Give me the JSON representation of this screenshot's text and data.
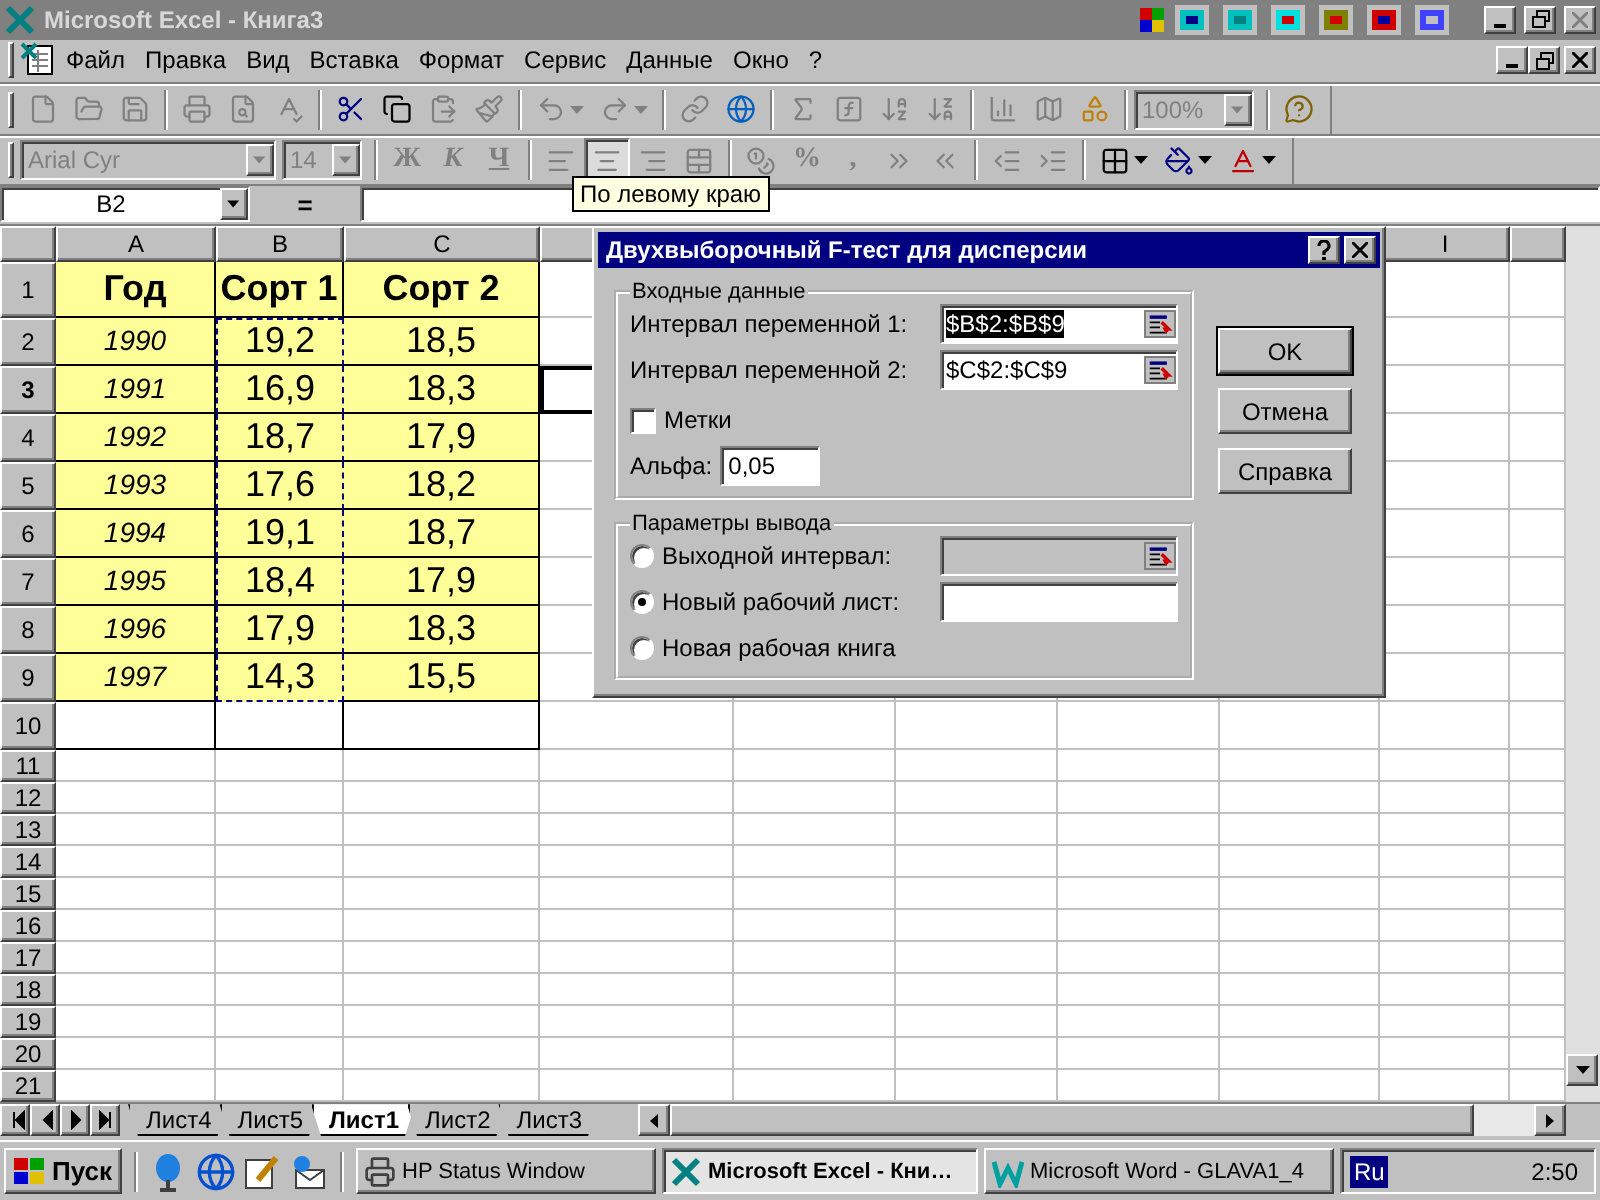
{
  "window": {
    "title": "Microsoft Excel - Книга3"
  },
  "menu": [
    "Файл",
    "Правка",
    "Вид",
    "Вставка",
    "Формат",
    "Сервис",
    "Данные",
    "Окно",
    "?"
  ],
  "standard_toolbar": [
    {
      "kind": "new",
      "disabled": true
    },
    {
      "kind": "open",
      "disabled": true
    },
    {
      "kind": "save",
      "disabled": true
    },
    {
      "kind": "separator"
    },
    {
      "kind": "print",
      "disabled": true
    },
    {
      "kind": "preview",
      "disabled": true
    },
    {
      "kind": "spelling",
      "disabled": true
    },
    {
      "kind": "separator"
    },
    {
      "kind": "cut",
      "disabled": false
    },
    {
      "kind": "copy",
      "disabled": false
    },
    {
      "kind": "paste",
      "disabled": true
    },
    {
      "kind": "painter",
      "disabled": true
    },
    {
      "kind": "separator"
    },
    {
      "kind": "undo",
      "disabled": true
    },
    {
      "kind": "redo",
      "disabled": true
    },
    {
      "kind": "separator"
    },
    {
      "kind": "hyperlink",
      "disabled": true
    },
    {
      "kind": "web",
      "disabled": false
    },
    {
      "kind": "separator"
    },
    {
      "kind": "sum",
      "disabled": true
    },
    {
      "kind": "function",
      "disabled": true
    },
    {
      "kind": "sort-asc",
      "disabled": true
    },
    {
      "kind": "sort-desc",
      "disabled": true
    },
    {
      "kind": "separator"
    },
    {
      "kind": "chart",
      "disabled": true
    },
    {
      "kind": "map",
      "disabled": true
    },
    {
      "kind": "drawing",
      "disabled": false
    },
    {
      "kind": "separator"
    },
    {
      "kind": "zoom",
      "value": "100%",
      "disabled": true
    },
    {
      "kind": "separator"
    },
    {
      "kind": "assistant",
      "disabled": false
    }
  ],
  "formatting_toolbar": [
    {
      "kind": "font",
      "value": "Arial Cyr",
      "disabled": true
    },
    {
      "kind": "size",
      "value": "14",
      "disabled": true
    },
    {
      "kind": "separator"
    },
    {
      "kind": "bold",
      "label": "Ж",
      "disabled": true
    },
    {
      "kind": "italic",
      "label": "К",
      "disabled": true
    },
    {
      "kind": "underline",
      "label": "Ч",
      "disabled": true
    },
    {
      "kind": "separator"
    },
    {
      "kind": "align-left",
      "disabled": true,
      "pressed": false
    },
    {
      "kind": "align-center",
      "disabled": true,
      "pressed": true
    },
    {
      "kind": "align-right",
      "disabled": true,
      "pressed": false
    },
    {
      "kind": "merge",
      "disabled": true
    },
    {
      "kind": "separator"
    },
    {
      "kind": "currency",
      "disabled": true
    },
    {
      "kind": "percent",
      "label": "%",
      "disabled": true
    },
    {
      "kind": "comma",
      "label": ",",
      "disabled": true
    },
    {
      "kind": "decimals-up",
      "disabled": true
    },
    {
      "kind": "decimals-down",
      "disabled": true
    },
    {
      "kind": "separator"
    },
    {
      "kind": "outdent",
      "disabled": true
    },
    {
      "kind": "indent",
      "disabled": true
    },
    {
      "kind": "separator"
    },
    {
      "kind": "borders",
      "disabled": false
    },
    {
      "kind": "fill",
      "disabled": false
    },
    {
      "kind": "font-color",
      "disabled": false
    }
  ],
  "tooltip": "По левому краю",
  "name_box": "B2",
  "formula_label": "=",
  "column_headers": [
    "A",
    "B",
    "C",
    "I"
  ],
  "rows": [
    {
      "header": "1",
      "kind": "header",
      "active": false,
      "marquee": false,
      "cells": [
        "Год",
        "Сорт 1",
        "Сорт 2"
      ]
    },
    {
      "header": "2",
      "kind": "data",
      "active": false,
      "marquee": true,
      "cells": [
        "1990",
        "19,2",
        "18,5"
      ]
    },
    {
      "header": "3",
      "kind": "data",
      "active": true,
      "marquee": true,
      "cells": [
        "1991",
        "16,9",
        "18,3"
      ]
    },
    {
      "header": "4",
      "kind": "data",
      "active": false,
      "marquee": true,
      "cells": [
        "1992",
        "18,7",
        "17,9"
      ]
    },
    {
      "header": "5",
      "kind": "data",
      "active": false,
      "marquee": true,
      "cells": [
        "1993",
        "17,6",
        "18,2"
      ]
    },
    {
      "header": "6",
      "kind": "data",
      "active": false,
      "marquee": true,
      "cells": [
        "1994",
        "19,1",
        "18,7"
      ]
    },
    {
      "header": "7",
      "kind": "data",
      "active": false,
      "marquee": true,
      "cells": [
        "1995",
        "18,4",
        "17,9"
      ]
    },
    {
      "header": "8",
      "kind": "data",
      "active": false,
      "marquee": true,
      "cells": [
        "1996",
        "17,9",
        "18,3"
      ]
    },
    {
      "header": "9",
      "kind": "data",
      "active": false,
      "marquee": true,
      "cells": [
        "1997",
        "14,3",
        "15,5"
      ]
    },
    {
      "header": "10",
      "kind": "bordered",
      "active": false,
      "marquee": false
    },
    {
      "header": "11",
      "kind": "plain",
      "active": false,
      "marquee": false
    },
    {
      "header": "12",
      "kind": "plain",
      "active": false,
      "marquee": false
    },
    {
      "header": "13",
      "kind": "plain",
      "active": false,
      "marquee": false
    },
    {
      "header": "14",
      "kind": "plain",
      "active": false,
      "marquee": false
    },
    {
      "header": "15",
      "kind": "plain",
      "active": false,
      "marquee": false
    },
    {
      "header": "16",
      "kind": "plain",
      "active": false,
      "marquee": false
    },
    {
      "header": "17",
      "kind": "plain",
      "active": false,
      "marquee": false
    },
    {
      "header": "18",
      "kind": "plain",
      "active": false,
      "marquee": false
    },
    {
      "header": "19",
      "kind": "plain",
      "active": false,
      "marquee": false
    },
    {
      "header": "20",
      "kind": "plain",
      "active": false,
      "marquee": false
    },
    {
      "header": "21",
      "kind": "plain",
      "active": false,
      "marquee": false
    }
  ],
  "sheet_tabs": [
    {
      "label": "Лист4",
      "selected": false
    },
    {
      "label": "Лист5",
      "selected": false
    },
    {
      "label": "Лист1",
      "selected": true
    },
    {
      "label": "Лист2",
      "selected": false
    },
    {
      "label": "Лист3",
      "selected": false
    }
  ],
  "dialog": {
    "title": "Двухвыборочный F-тест для дисперсии",
    "input_group": {
      "title": "Входные данные",
      "ranges": [
        {
          "label": "Интервал переменной 1:",
          "value": "$B$2:$B$9",
          "highlighted": true
        },
        {
          "label": "Интервал переменной 2:",
          "value": "$C$2:$C$9",
          "highlighted": false
        }
      ],
      "labels_checkbox": {
        "label": "Метки",
        "checked": false
      },
      "alpha": {
        "label": "Альфа:",
        "value": "0,05"
      }
    },
    "output_group": {
      "title": "Параметры вывода",
      "options": [
        {
          "label": "Выходной интервал:",
          "selected": false,
          "kind": "range",
          "disabled": true
        },
        {
          "label": "Новый рабочий лист:",
          "selected": true,
          "kind": "text",
          "disabled": false
        },
        {
          "label": "Новая рабочая книга",
          "selected": false,
          "kind": "plain"
        }
      ]
    },
    "buttons": [
      {
        "label": "OK",
        "default": true
      },
      {
        "label": "Отмена",
        "default": false
      },
      {
        "label": "Справка",
        "default": false
      }
    ]
  },
  "taskbar": {
    "start": "Пуск",
    "tasks": [
      {
        "kind": "printer",
        "label": "HP Status Window",
        "selected": false
      },
      {
        "kind": "excel",
        "label": "Microsoft Excel - Кни…",
        "selected": true
      },
      {
        "kind": "word",
        "label": "Microsoft Word - GLAVA1_4",
        "selected": false
      }
    ],
    "language": "Ru",
    "clock": "2:50"
  }
}
